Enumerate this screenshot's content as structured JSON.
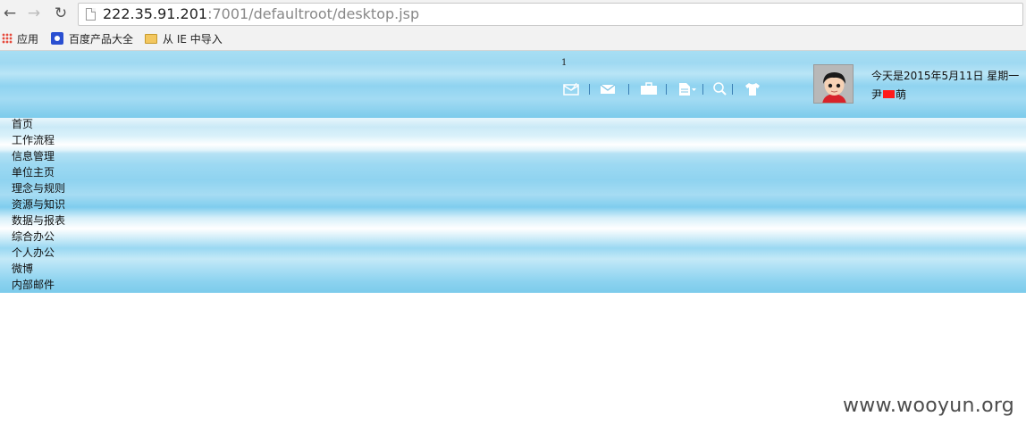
{
  "browser": {
    "url_host": "222.35.91.201",
    "url_rest": ":7001/defaultroot/desktop.jsp"
  },
  "bookmarks": [
    {
      "label": "应用",
      "icon": "apps-grid-icon"
    },
    {
      "label": "百度产品大全",
      "icon": "baidu-paw-icon"
    },
    {
      "label": "从 IE 中导入",
      "icon": "folder-icon"
    }
  ],
  "header": {
    "notification_count": "1",
    "toolbar_icons": [
      "mail-open-icon",
      "mail-icon",
      "briefcase-icon",
      "document-icon",
      "search-icon",
      "shirt-icon"
    ],
    "date_text": "今天是2015年5月11日  星期一",
    "user_name_start": "尹",
    "user_name_end": "萌",
    "accent_color": "#a7def3"
  },
  "menu": {
    "items": [
      "首页",
      "工作流程",
      "信息管理",
      "单位主页",
      "理念与规则",
      "资源与知识",
      "数据与报表",
      "综合办公",
      "个人办公",
      "微博",
      "内部邮件"
    ]
  },
  "watermark": "www.wooyun.org"
}
